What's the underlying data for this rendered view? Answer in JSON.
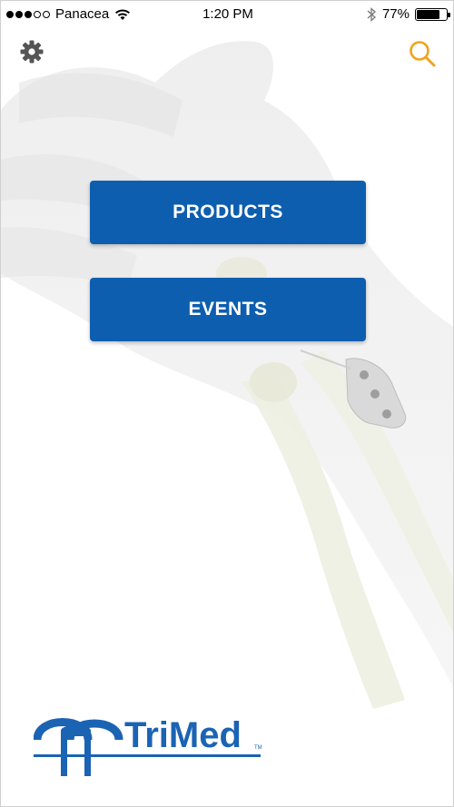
{
  "status_bar": {
    "carrier": "Panacea",
    "time": "1:20 PM",
    "battery_percent": "77%",
    "battery_level": 0.77,
    "signal_bars_filled": 3,
    "signal_bars_total": 5
  },
  "toolbar": {
    "settings_icon": "gear-icon",
    "search_icon": "search-icon"
  },
  "menu": {
    "products_label": "PRODUCTS",
    "events_label": "EVENTS"
  },
  "logo": {
    "brand": "TriMed",
    "trademark": "TM"
  },
  "colors": {
    "button_blue": "#0d5eaf",
    "search_orange": "#f0a31f",
    "gear_gray": "#555555",
    "logo_blue": "#1b63b3"
  }
}
